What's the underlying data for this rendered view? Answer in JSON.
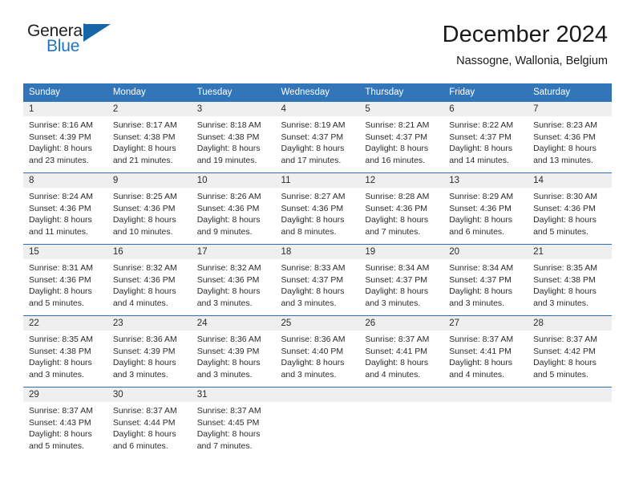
{
  "logo": {
    "word_top": "General",
    "word_bottom": "Blue",
    "triangle": "blue-triangle",
    "accent_color": "#1565a8"
  },
  "header": {
    "title": "December 2024",
    "subtitle": "Nassogne, Wallonia, Belgium"
  },
  "calendar": {
    "header_bg": "#3275b9",
    "row_separator_color": "#2d6fb5",
    "daynum_band_color": "#efefef",
    "weekdays": [
      "Sunday",
      "Monday",
      "Tuesday",
      "Wednesday",
      "Thursday",
      "Friday",
      "Saturday"
    ],
    "weeks": [
      [
        {
          "day": "1",
          "sunrise": "Sunrise: 8:16 AM",
          "sunset": "Sunset: 4:39 PM",
          "daylight1": "Daylight: 8 hours",
          "daylight2": "and 23 minutes."
        },
        {
          "day": "2",
          "sunrise": "Sunrise: 8:17 AM",
          "sunset": "Sunset: 4:38 PM",
          "daylight1": "Daylight: 8 hours",
          "daylight2": "and 21 minutes."
        },
        {
          "day": "3",
          "sunrise": "Sunrise: 8:18 AM",
          "sunset": "Sunset: 4:38 PM",
          "daylight1": "Daylight: 8 hours",
          "daylight2": "and 19 minutes."
        },
        {
          "day": "4",
          "sunrise": "Sunrise: 8:19 AM",
          "sunset": "Sunset: 4:37 PM",
          "daylight1": "Daylight: 8 hours",
          "daylight2": "and 17 minutes."
        },
        {
          "day": "5",
          "sunrise": "Sunrise: 8:21 AM",
          "sunset": "Sunset: 4:37 PM",
          "daylight1": "Daylight: 8 hours",
          "daylight2": "and 16 minutes."
        },
        {
          "day": "6",
          "sunrise": "Sunrise: 8:22 AM",
          "sunset": "Sunset: 4:37 PM",
          "daylight1": "Daylight: 8 hours",
          "daylight2": "and 14 minutes."
        },
        {
          "day": "7",
          "sunrise": "Sunrise: 8:23 AM",
          "sunset": "Sunset: 4:36 PM",
          "daylight1": "Daylight: 8 hours",
          "daylight2": "and 13 minutes."
        }
      ],
      [
        {
          "day": "8",
          "sunrise": "Sunrise: 8:24 AM",
          "sunset": "Sunset: 4:36 PM",
          "daylight1": "Daylight: 8 hours",
          "daylight2": "and 11 minutes."
        },
        {
          "day": "9",
          "sunrise": "Sunrise: 8:25 AM",
          "sunset": "Sunset: 4:36 PM",
          "daylight1": "Daylight: 8 hours",
          "daylight2": "and 10 minutes."
        },
        {
          "day": "10",
          "sunrise": "Sunrise: 8:26 AM",
          "sunset": "Sunset: 4:36 PM",
          "daylight1": "Daylight: 8 hours",
          "daylight2": "and 9 minutes."
        },
        {
          "day": "11",
          "sunrise": "Sunrise: 8:27 AM",
          "sunset": "Sunset: 4:36 PM",
          "daylight1": "Daylight: 8 hours",
          "daylight2": "and 8 minutes."
        },
        {
          "day": "12",
          "sunrise": "Sunrise: 8:28 AM",
          "sunset": "Sunset: 4:36 PM",
          "daylight1": "Daylight: 8 hours",
          "daylight2": "and 7 minutes."
        },
        {
          "day": "13",
          "sunrise": "Sunrise: 8:29 AM",
          "sunset": "Sunset: 4:36 PM",
          "daylight1": "Daylight: 8 hours",
          "daylight2": "and 6 minutes."
        },
        {
          "day": "14",
          "sunrise": "Sunrise: 8:30 AM",
          "sunset": "Sunset: 4:36 PM",
          "daylight1": "Daylight: 8 hours",
          "daylight2": "and 5 minutes."
        }
      ],
      [
        {
          "day": "15",
          "sunrise": "Sunrise: 8:31 AM",
          "sunset": "Sunset: 4:36 PM",
          "daylight1": "Daylight: 8 hours",
          "daylight2": "and 5 minutes."
        },
        {
          "day": "16",
          "sunrise": "Sunrise: 8:32 AM",
          "sunset": "Sunset: 4:36 PM",
          "daylight1": "Daylight: 8 hours",
          "daylight2": "and 4 minutes."
        },
        {
          "day": "17",
          "sunrise": "Sunrise: 8:32 AM",
          "sunset": "Sunset: 4:36 PM",
          "daylight1": "Daylight: 8 hours",
          "daylight2": "and 3 minutes."
        },
        {
          "day": "18",
          "sunrise": "Sunrise: 8:33 AM",
          "sunset": "Sunset: 4:37 PM",
          "daylight1": "Daylight: 8 hours",
          "daylight2": "and 3 minutes."
        },
        {
          "day": "19",
          "sunrise": "Sunrise: 8:34 AM",
          "sunset": "Sunset: 4:37 PM",
          "daylight1": "Daylight: 8 hours",
          "daylight2": "and 3 minutes."
        },
        {
          "day": "20",
          "sunrise": "Sunrise: 8:34 AM",
          "sunset": "Sunset: 4:37 PM",
          "daylight1": "Daylight: 8 hours",
          "daylight2": "and 3 minutes."
        },
        {
          "day": "21",
          "sunrise": "Sunrise: 8:35 AM",
          "sunset": "Sunset: 4:38 PM",
          "daylight1": "Daylight: 8 hours",
          "daylight2": "and 3 minutes."
        }
      ],
      [
        {
          "day": "22",
          "sunrise": "Sunrise: 8:35 AM",
          "sunset": "Sunset: 4:38 PM",
          "daylight1": "Daylight: 8 hours",
          "daylight2": "and 3 minutes."
        },
        {
          "day": "23",
          "sunrise": "Sunrise: 8:36 AM",
          "sunset": "Sunset: 4:39 PM",
          "daylight1": "Daylight: 8 hours",
          "daylight2": "and 3 minutes."
        },
        {
          "day": "24",
          "sunrise": "Sunrise: 8:36 AM",
          "sunset": "Sunset: 4:39 PM",
          "daylight1": "Daylight: 8 hours",
          "daylight2": "and 3 minutes."
        },
        {
          "day": "25",
          "sunrise": "Sunrise: 8:36 AM",
          "sunset": "Sunset: 4:40 PM",
          "daylight1": "Daylight: 8 hours",
          "daylight2": "and 3 minutes."
        },
        {
          "day": "26",
          "sunrise": "Sunrise: 8:37 AM",
          "sunset": "Sunset: 4:41 PM",
          "daylight1": "Daylight: 8 hours",
          "daylight2": "and 4 minutes."
        },
        {
          "day": "27",
          "sunrise": "Sunrise: 8:37 AM",
          "sunset": "Sunset: 4:41 PM",
          "daylight1": "Daylight: 8 hours",
          "daylight2": "and 4 minutes."
        },
        {
          "day": "28",
          "sunrise": "Sunrise: 8:37 AM",
          "sunset": "Sunset: 4:42 PM",
          "daylight1": "Daylight: 8 hours",
          "daylight2": "and 5 minutes."
        }
      ],
      [
        {
          "day": "29",
          "sunrise": "Sunrise: 8:37 AM",
          "sunset": "Sunset: 4:43 PM",
          "daylight1": "Daylight: 8 hours",
          "daylight2": "and 5 minutes."
        },
        {
          "day": "30",
          "sunrise": "Sunrise: 8:37 AM",
          "sunset": "Sunset: 4:44 PM",
          "daylight1": "Daylight: 8 hours",
          "daylight2": "and 6 minutes."
        },
        {
          "day": "31",
          "sunrise": "Sunrise: 8:37 AM",
          "sunset": "Sunset: 4:45 PM",
          "daylight1": "Daylight: 8 hours",
          "daylight2": "and 7 minutes."
        },
        {
          "day": "",
          "sunrise": "",
          "sunset": "",
          "daylight1": "",
          "daylight2": ""
        },
        {
          "day": "",
          "sunrise": "",
          "sunset": "",
          "daylight1": "",
          "daylight2": ""
        },
        {
          "day": "",
          "sunrise": "",
          "sunset": "",
          "daylight1": "",
          "daylight2": ""
        },
        {
          "day": "",
          "sunrise": "",
          "sunset": "",
          "daylight1": "",
          "daylight2": ""
        }
      ]
    ]
  }
}
